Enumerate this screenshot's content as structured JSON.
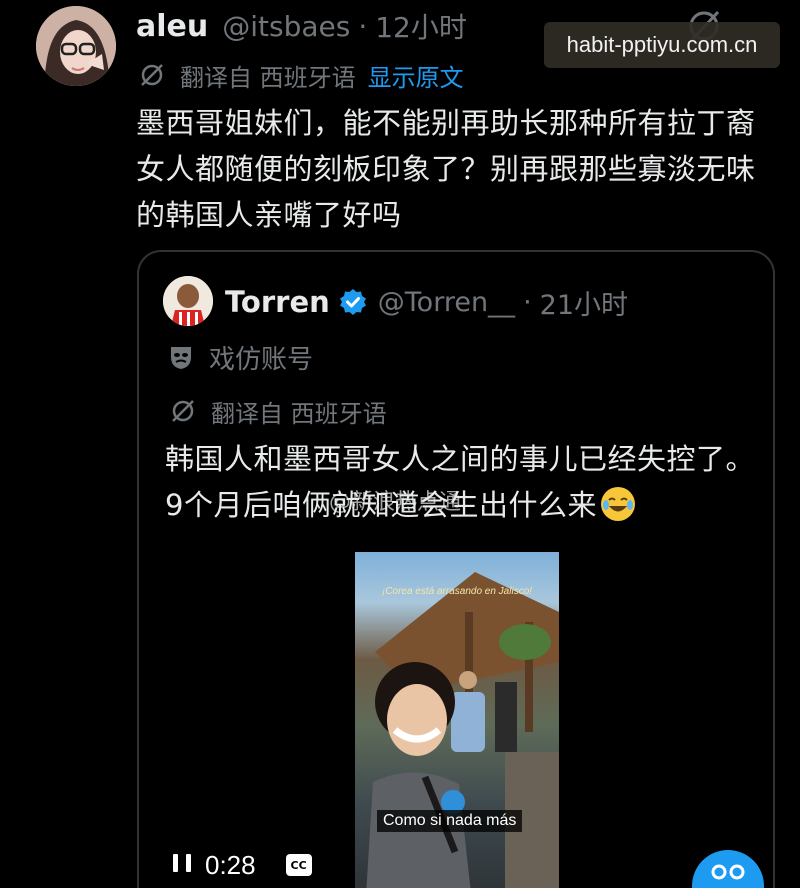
{
  "tweet": {
    "author_name": "aleu",
    "handle": "@itsbaes",
    "separator": "·",
    "time": "12小时",
    "translated_from": "翻译自 西班牙语",
    "show_original": "显示原文",
    "text": "墨西哥姐妹们，能不能别再助长那种所有拉丁裔女人都随便的刻板印象了？别再跟那些寡淡无味的韩国人亲嘴了好吗"
  },
  "watermark": "habit-pptiyu.com.cn",
  "quoted": {
    "author_name": "Torren",
    "handle": "@Torren__",
    "separator": "·",
    "time": "21小时",
    "parody_label": "戏仿账号",
    "translated_from": "翻译自 西班牙语",
    "text": "韩国人和墨西哥女人之间的事儿已经失控了。9个月后咱俩就知道会生出什么来",
    "overlay_watermark": "@新浪热点通",
    "video": {
      "top_caption": "¡Corea está arrasando en Jalisco!",
      "subtitle": "Como si nada más",
      "elapsed": "0:28",
      "cc_label": "CC"
    }
  },
  "icons": {
    "translate": "translate-icon",
    "grok": "grok-icon",
    "parody": "theater-mask-icon",
    "verified": "verified-badge-icon",
    "pause": "pause-icon",
    "captions": "cc-icon"
  },
  "colors": {
    "background": "#000000",
    "text": "#e7e9ea",
    "muted": "#71767b",
    "accent": "#1d9bf0"
  }
}
